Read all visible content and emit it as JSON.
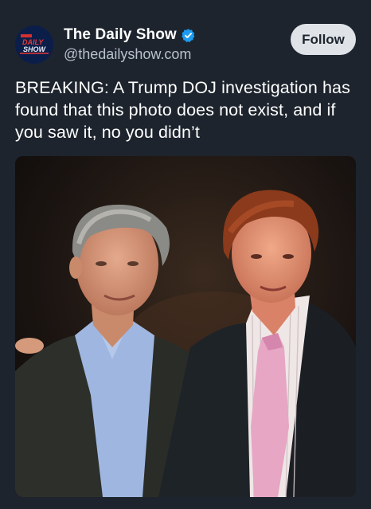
{
  "post": {
    "author": {
      "display_name": "The Daily Show",
      "handle": "@thedailyshow.com",
      "verified": true,
      "avatar_logo_text": "THE DAILY SHOW"
    },
    "follow_label": "Follow",
    "text": "BREAKING: A Trump DOJ investigation has found that this photo does not exist, and if you saw it, no you didn’t"
  },
  "colors": {
    "background": "#1d242d",
    "follow_button_bg": "#dfe3e8",
    "verified_badge": "#1d9bf0",
    "handle_text": "#b8c2cd"
  },
  "icons": {
    "verified": "verified-check-icon"
  }
}
